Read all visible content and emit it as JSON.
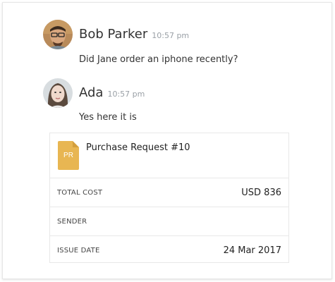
{
  "messages": [
    {
      "sender": "Bob Parker",
      "time": "10:57 pm",
      "text": "Did Jane order an iphone recently?",
      "avatar": "bob-avatar"
    },
    {
      "sender": "Ada",
      "time": "10:57 pm",
      "text": "Yes here it is",
      "avatar": "ada-avatar"
    }
  ],
  "card": {
    "icon_label": "PR",
    "icon_color": "#e8b652",
    "title": "Purchase Request #10",
    "rows": [
      {
        "label": "TOTAL COST",
        "value": "USD 836"
      },
      {
        "label": "SENDER",
        "value": ""
      },
      {
        "label": "ISSUE DATE",
        "value": "24 Mar 2017"
      }
    ]
  }
}
